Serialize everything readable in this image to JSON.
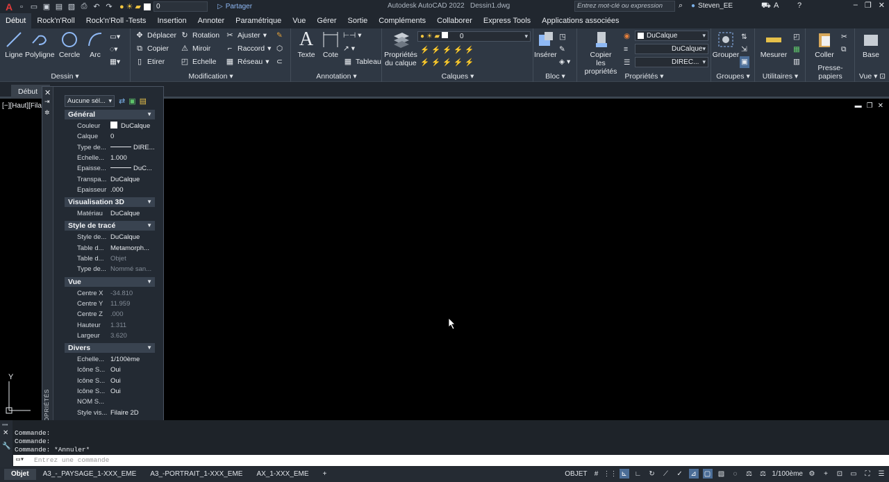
{
  "titlebar": {
    "app_logo": "A",
    "layer_value": "0",
    "share_label": "Partager",
    "app_title": "Autodesk AutoCAD 2022",
    "file_name": "Dessin1.dwg",
    "search_placeholder": "Entrez mot-clé ou expression",
    "user_name": "Steven_EE"
  },
  "tabs": [
    "Début",
    "Rock'n'Roll",
    "Rock'n'Roll -Tests",
    "Insertion",
    "Annoter",
    "Paramétrique",
    "Vue",
    "Gérer",
    "Sortie",
    "Compléments",
    "Collaborer",
    "Express Tools",
    "Applications associées"
  ],
  "ribbon": {
    "dessin": {
      "title": "Dessin",
      "buttons": [
        "Ligne",
        "Polyligne",
        "Cercle",
        "Arc"
      ]
    },
    "modification": {
      "title": "Modification",
      "buttons": [
        "Déplacer",
        "Rotation",
        "Ajuster",
        "Copier",
        "Miroir",
        "Raccord",
        "Etirer",
        "Echelle",
        "Réseau"
      ]
    },
    "annotation": {
      "title": "Annotation",
      "texte": "Texte",
      "cote": "Cote",
      "tableau": "Tableau"
    },
    "calques": {
      "title": "Calques",
      "proprietes_l1": "Propriétés",
      "proprietes_l2": "du calque",
      "layer_value": "0"
    },
    "bloc": {
      "title": "Bloc",
      "inserer": "Insérer"
    },
    "proprietes": {
      "title": "Propriétés",
      "copier_l1": "Copier",
      "copier_l2": "les propriétés",
      "color_value": "DuCalque",
      "lineweight_value": "DuCalque",
      "linetype_value": "DIREC..."
    },
    "groupes": {
      "title": "Groupes",
      "grouper": "Grouper"
    },
    "utilitaires": {
      "title": "Utilitaires",
      "mesurer": "Mesurer"
    },
    "presse_papiers": {
      "title": "Presse-papiers",
      "coller": "Coller"
    },
    "vue": {
      "title": "Vue",
      "base": "Base"
    }
  },
  "filetab": {
    "label": "Début"
  },
  "viewport": {
    "label": "[−][Haut][Fila",
    "ucs_y": "Y"
  },
  "properties_palette": {
    "vertical_title": "PROPRIÉTÉS",
    "selection": "Aucune sél...",
    "sections": [
      {
        "title": "Général",
        "rows": [
          {
            "key": "Couleur",
            "value": "DuCalque"
          },
          {
            "key": "Calque",
            "value": "0"
          },
          {
            "key": "Type de...",
            "value": "DIRE..."
          },
          {
            "key": "Echelle...",
            "value": "1.000"
          },
          {
            "key": "Epaisse...",
            "value": "DuC..."
          },
          {
            "key": "Transpa...",
            "value": "DuCalque"
          },
          {
            "key": "Epaisseur",
            "value": ".000"
          }
        ]
      },
      {
        "title": "Visualisation 3D",
        "rows": [
          {
            "key": "Matériau",
            "value": "DuCalque"
          }
        ]
      },
      {
        "title": "Style de tracé",
        "rows": [
          {
            "key": "Style de...",
            "value": "DuCalque"
          },
          {
            "key": "Table d...",
            "value": "Metamorph..."
          },
          {
            "key": "Table d...",
            "value": "Objet"
          },
          {
            "key": "Type de...",
            "value": "Nommé san..."
          }
        ]
      },
      {
        "title": "Vue",
        "rows": [
          {
            "key": "Centre X",
            "value": "-34.810"
          },
          {
            "key": "Centre Y",
            "value": "11.959"
          },
          {
            "key": "Centre Z",
            "value": ".000"
          },
          {
            "key": "Hauteur",
            "value": "1.311"
          },
          {
            "key": "Largeur",
            "value": "3.620"
          }
        ]
      },
      {
        "title": "Divers",
        "rows": [
          {
            "key": "Echelle...",
            "value": "1/100ème"
          },
          {
            "key": "Icône S...",
            "value": "Oui"
          },
          {
            "key": "Icône S...",
            "value": "Oui"
          },
          {
            "key": "Icône S...",
            "value": "Oui"
          },
          {
            "key": "NOM S...",
            "value": ""
          },
          {
            "key": "Style vis...",
            "value": "Filaire 2D"
          }
        ]
      }
    ]
  },
  "command": {
    "history": [
      "Commande:",
      "Commande:",
      "Commande: *Annuler*"
    ],
    "placeholder": "Entrez une commande"
  },
  "statusbar": {
    "layout_tabs": [
      "Objet",
      "A3_-_PAYSAGE_1-XXX_EME",
      "A3_-PORTRAIT_1-XXX_EME",
      "AX_1-XXX_EME"
    ],
    "add_tab": "+",
    "mode": "OBJET",
    "scale": "1/100ème"
  }
}
